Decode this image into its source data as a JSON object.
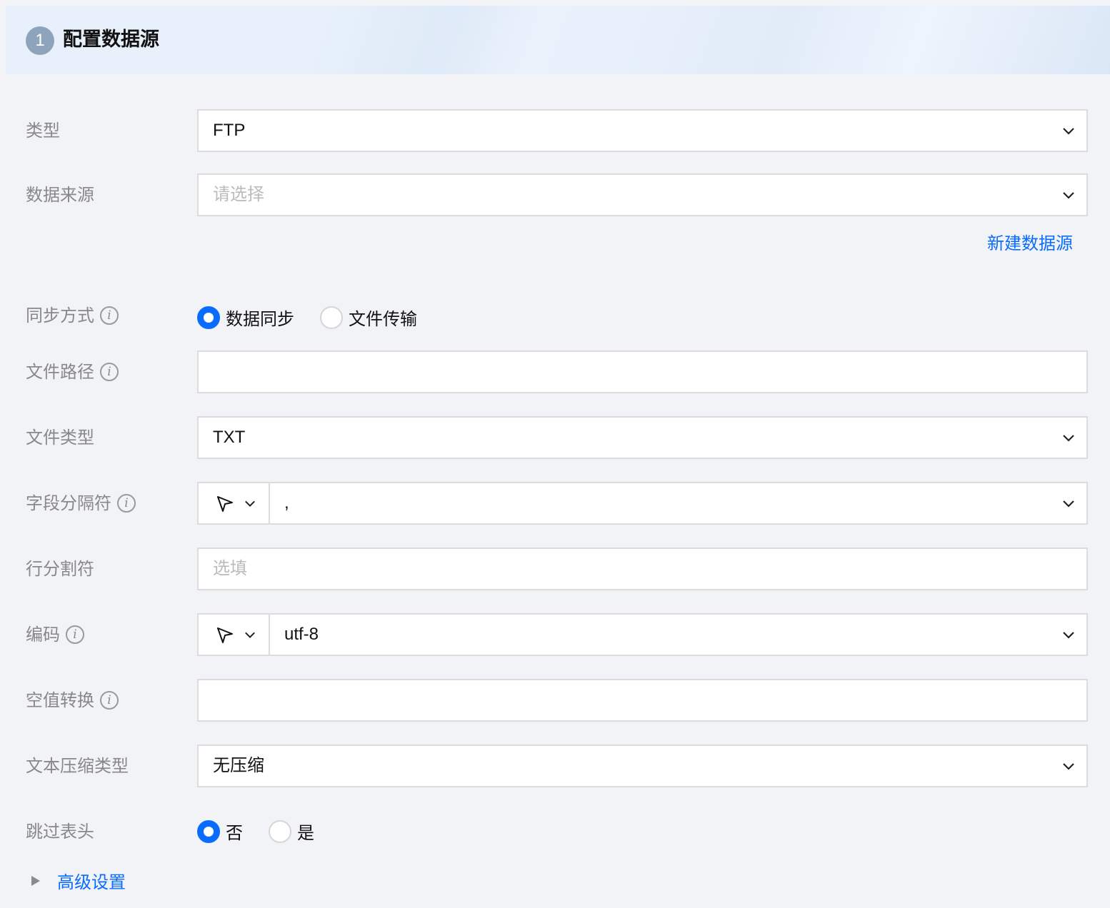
{
  "section": {
    "step": "1",
    "title": "配置数据源"
  },
  "fields": {
    "type": {
      "label": "类型",
      "value": "FTP"
    },
    "source": {
      "label": "数据来源",
      "placeholder": "请选择"
    },
    "new_source_link": "新建数据源",
    "sync_mode": {
      "label": "同步方式",
      "options": [
        "数据同步",
        "文件传输"
      ],
      "selected": "数据同步"
    },
    "file_path": {
      "label": "文件路径",
      "value": ""
    },
    "file_type": {
      "label": "文件类型",
      "value": "TXT"
    },
    "field_delimiter": {
      "label": "字段分隔符",
      "value": ","
    },
    "row_delimiter": {
      "label": "行分割符",
      "placeholder": "选填"
    },
    "encoding": {
      "label": "编码",
      "value": "utf-8"
    },
    "null_conversion": {
      "label": "空值转换",
      "value": ""
    },
    "compression": {
      "label": "文本压缩类型",
      "value": "无压缩"
    },
    "skip_header": {
      "label": "跳过表头",
      "options": [
        "否",
        "是"
      ],
      "selected": "否"
    },
    "advanced": "高级设置"
  },
  "icons": {
    "info": "info-icon",
    "chevron": "chevron-down-icon",
    "cursor": "cursor-pointer-icon",
    "expand": "triangle-right-icon"
  },
  "colors": {
    "accent": "#0a6cff",
    "label": "#888888",
    "badge": "#8ea4bd"
  }
}
